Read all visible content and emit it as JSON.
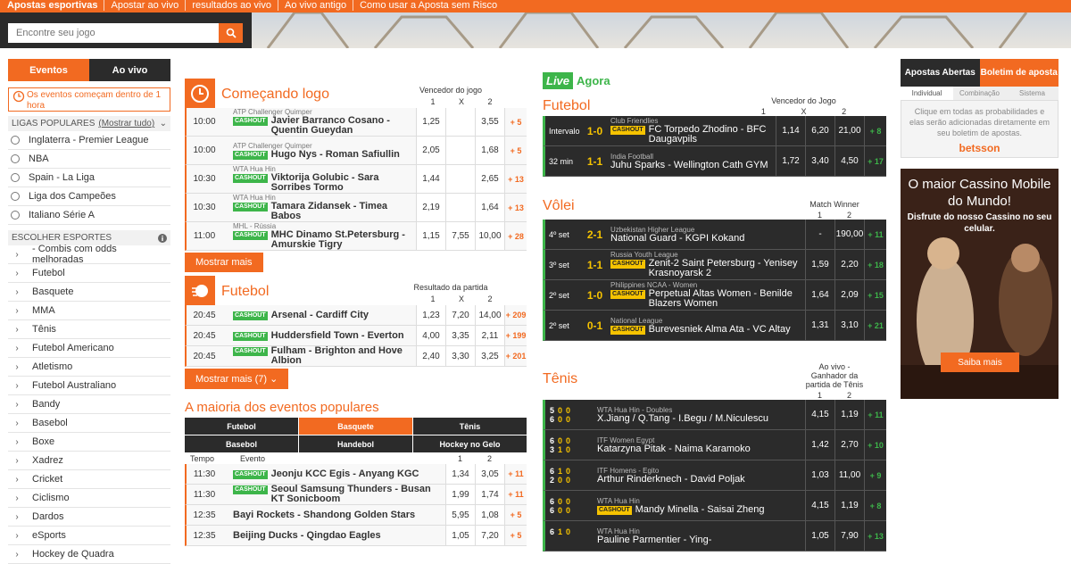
{
  "topnav": [
    "Apostas esportivas",
    "Apostar ao vivo",
    "resultados ao vivo",
    "Ao vivo antigo",
    "Como usar a Aposta sem Risco"
  ],
  "search": {
    "placeholder": "Encontre seu jogo",
    "icon": "search-icon"
  },
  "left": {
    "tabs": [
      "Eventos",
      "Ao vivo"
    ],
    "note": "Os eventos começam dentro de 1 hora",
    "popular_header": "Ligas populares",
    "popular_show_all": "(Mostrar tudo)",
    "leagues": [
      "Inglaterra - Premier League",
      "NBA",
      "Spain - La Liga",
      "Liga dos Campeões",
      "Italiano Série A"
    ],
    "sports_header": "Escolher esportes",
    "sports": [
      "- Combis com odds melhoradas",
      "Futebol",
      "Basquete",
      "MMA",
      "Tênis",
      "Futebol Americano",
      "Atletismo",
      "Futebol Australiano",
      "Bandy",
      "Basebol",
      "Boxe",
      "Xadrez",
      "Cricket",
      "Ciclismo",
      "Dardos",
      "eSports",
      "Hockey de Quadra"
    ]
  },
  "soon": {
    "title": "Começando logo",
    "market": "Vencedor do jogo",
    "cols": [
      "1",
      "X",
      "2"
    ],
    "events": [
      {
        "time": "10:00",
        "league": "ATP Challenger Quimper",
        "name": "Javier Barranco Cosano - Quentin Gueydan",
        "o1": "1,25",
        "ox": "",
        "o2": "3,55",
        "more": "+ 5"
      },
      {
        "time": "10:00",
        "league": "ATP Challenger Quimper",
        "name": "Hugo Nys - Roman Safiullin",
        "o1": "2,05",
        "ox": "",
        "o2": "1,68",
        "more": "+ 5"
      },
      {
        "time": "10:30",
        "league": "WTA Hua Hin",
        "name": "Viktorija Golubic - Sara Sorribes Tormo",
        "o1": "1,44",
        "ox": "",
        "o2": "2,65",
        "more": "+ 13"
      },
      {
        "time": "10:30",
        "league": "WTA Hua Hin",
        "name": "Tamara Zidansek - Timea Babos",
        "o1": "2,19",
        "ox": "",
        "o2": "1,64",
        "more": "+ 13"
      },
      {
        "time": "11:00",
        "league": "MHL - Rússia",
        "name": "MHC Dinamo St.Petersburg - Amurskie Tigry",
        "o1": "1,15",
        "ox": "7,55",
        "o2": "10,00",
        "more": "+ 28"
      }
    ],
    "cashout": "CASHOUT",
    "more_btn": "Mostrar mais"
  },
  "football": {
    "title": "Futebol",
    "market": "Resultado da partida",
    "cols": [
      "1",
      "X",
      "2"
    ],
    "events": [
      {
        "time": "20:45",
        "name": "Arsenal - Cardiff City",
        "o1": "1,23",
        "ox": "7,20",
        "o2": "14,00",
        "more": "+ 209"
      },
      {
        "time": "20:45",
        "name": "Huddersfield Town - Everton",
        "o1": "4,00",
        "ox": "3,35",
        "o2": "2,11",
        "more": "+ 199"
      },
      {
        "time": "20:45",
        "name": "Fulham - Brighton and Hove Albion",
        "o1": "2,40",
        "ox": "3,30",
        "o2": "3,25",
        "more": "+ 201"
      }
    ],
    "more_btn": "Mostrar mais (7)"
  },
  "popular": {
    "title": "A maioria dos eventos populares",
    "sports": [
      "Futebol",
      "Basquete",
      "Tênis",
      "Basebol",
      "Handebol",
      "Hockey no Gelo"
    ],
    "col_time": "Tempo",
    "col_event": "Evento",
    "cols": [
      "1",
      "2"
    ],
    "events": [
      {
        "time": "11:30",
        "name": "Jeonju KCC Egis - Anyang KGC",
        "o1": "1,34",
        "o2": "3,05",
        "more": "+ 11",
        "cashout": true
      },
      {
        "time": "11:30",
        "name": "Seoul Samsung Thunders - Busan KT Sonicboom",
        "o1": "1,99",
        "o2": "1,74",
        "more": "+ 11",
        "cashout": true
      },
      {
        "time": "12:35",
        "name": "Bayi Rockets - Shandong Golden Stars",
        "o1": "5,95",
        "o2": "1,08",
        "more": "+ 5",
        "cashout": false
      },
      {
        "time": "12:35",
        "name": "Beijing Ducks - Qingdao Eagles",
        "o1": "1,05",
        "o2": "7,20",
        "more": "+ 5",
        "cashout": false
      }
    ]
  },
  "live": {
    "badge": "Live",
    "label": "Agora",
    "football": {
      "title": "Futebol",
      "market": "Vencedor do Jogo",
      "cols": [
        "1",
        "X",
        "2"
      ],
      "events": [
        {
          "status": "Intervalo",
          "score": "1-0",
          "league": "Club Friendlies",
          "name": "FC Torpedo Zhodino - BFC Daugavpils",
          "o1": "1,14",
          "ox": "6,20",
          "o2": "21,00",
          "more": "+ 8",
          "cashout": true
        },
        {
          "status": "32 min",
          "score": "1-1",
          "league": "India Football",
          "name": "Juhu Sparks - Wellington Cath GYM",
          "o1": "1,72",
          "ox": "3,40",
          "o2": "4,50",
          "more": "+ 17",
          "cashout": false
        }
      ]
    },
    "volley": {
      "title": "Vôlei",
      "market": "Match Winner",
      "cols": [
        "1",
        "2"
      ],
      "events": [
        {
          "status": "4º set",
          "score": "2-1",
          "league": "Uzbekistan Higher League",
          "name": "National Guard - KGPI Kokand",
          "o1": "-",
          "o2": "190,00",
          "more": "+ 11",
          "cashout": false
        },
        {
          "status": "3º set",
          "score": "1-1",
          "league": "Russia Youth League",
          "name": "Zenit-2 Saint Petersburg - Yenisey Krasnoyarsk 2",
          "o1": "1,59",
          "o2": "2,20",
          "more": "+ 18",
          "cashout": true
        },
        {
          "status": "2º set",
          "score": "1-0",
          "league": "Philippines NCAA - Women",
          "name": "Perpetual Altas Women - Benilde Blazers Women",
          "o1": "1,64",
          "o2": "2,09",
          "more": "+ 15",
          "cashout": true
        },
        {
          "status": "2º set",
          "score": "0-1",
          "league": "National League",
          "name": "Burevesniek Alma Ata - VC Altay",
          "o1": "1,31",
          "o2": "3,10",
          "more": "+ 21",
          "cashout": true
        }
      ]
    },
    "tennis": {
      "title": "Tênis",
      "market": "Ao vivo - Ganhador da partida de Tênis",
      "cols": [
        "1",
        "2"
      ],
      "events": [
        {
          "s1": [
            "5",
            "0",
            "0"
          ],
          "s2": [
            "6",
            "0",
            "0"
          ],
          "league": "WTA Hua Hin - Doubles",
          "name": "X.Jiang / Q.Tang - I.Begu / M.Niculescu",
          "o1": "4,15",
          "o2": "1,19",
          "more": "+ 11",
          "cashout": false
        },
        {
          "s1": [
            "6",
            "0",
            "0"
          ],
          "s2": [
            "3",
            "1",
            "0"
          ],
          "league": "ITF Women Egypt",
          "name": "Katarzyna Pitak - Naima Karamoko",
          "o1": "1,42",
          "o2": "2,70",
          "more": "+ 10",
          "cashout": false
        },
        {
          "s1": [
            "6",
            "1",
            "0"
          ],
          "s2": [
            "2",
            "0",
            "0"
          ],
          "league": "ITF Homens - Egito",
          "name": "Arthur Rinderknech - David Poljak",
          "o1": "1,03",
          "o2": "11,00",
          "more": "+ 9",
          "cashout": false
        },
        {
          "s1": [
            "6",
            "0",
            "0"
          ],
          "s2": [
            "6",
            "0",
            "0"
          ],
          "league": "WTA Hua Hin",
          "name": "Mandy Minella - Saisai Zheng",
          "o1": "4,15",
          "o2": "1,19",
          "more": "+ 8",
          "cashout": true
        },
        {
          "s1": [
            "6",
            "1",
            "0"
          ],
          "s2": [
            "",
            "",
            ""
          ],
          "league": "WTA Hua Hin",
          "name": "Pauline Parmentier - Ying-",
          "o1": "1,05",
          "o2": "7,90",
          "more": "+ 13",
          "cashout": false
        }
      ]
    }
  },
  "slip": {
    "tabs": [
      "Apostas Abertas",
      "Boletim de aposta"
    ],
    "subtabs": [
      "Individual",
      "Combinação",
      "Sistema"
    ],
    "text": "Clique em todas as probabilidades e elas serão adicionadas diretamente em seu boletim de apostas.",
    "brand": "betsson"
  },
  "ad": {
    "title": "O maior Cassino Mobile do Mundo!",
    "subtitle": "Disfrute do nosso Cassino no seu celular.",
    "cta": "Saiba mais"
  },
  "colors": {
    "accent": "#f26a21",
    "dark": "#2b2b2b",
    "live": "#3db54a",
    "cashout": "#3db54a",
    "cashout_alt": "#f6c300"
  }
}
